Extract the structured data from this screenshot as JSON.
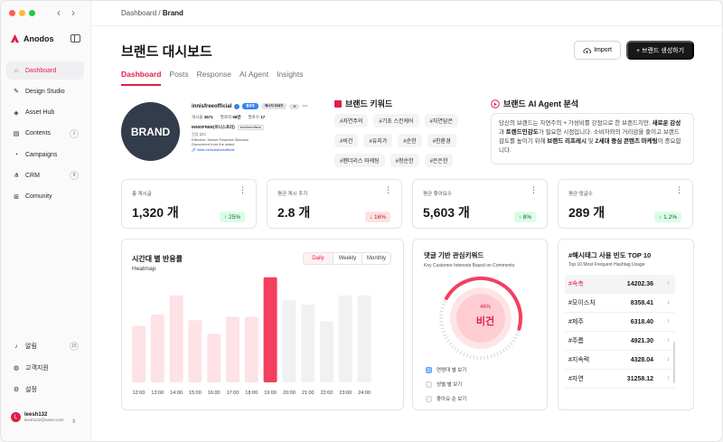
{
  "sidebar": {
    "logo": "Anodos",
    "items": [
      {
        "label": "Dashboard",
        "icon": "home-icon",
        "active": true,
        "badge": ""
      },
      {
        "label": "Design Studio",
        "icon": "pen-icon",
        "active": false,
        "badge": ""
      },
      {
        "label": "Asset Hub",
        "icon": "layers-icon",
        "active": false,
        "badge": ""
      },
      {
        "label": "Contents",
        "icon": "file-icon",
        "active": false,
        "badge": "1"
      },
      {
        "label": "Campaigns",
        "icon": "megaphone-icon",
        "active": false,
        "badge": ""
      },
      {
        "label": "CRM",
        "icon": "share-icon",
        "active": false,
        "badge": "8"
      },
      {
        "label": "Comunity",
        "icon": "grid-icon",
        "active": false,
        "badge": ""
      }
    ],
    "bottom_items": [
      {
        "label": "알림",
        "icon": "bell-icon",
        "badge": "15"
      },
      {
        "label": "고객지원",
        "icon": "chat-icon",
        "badge": ""
      },
      {
        "label": "설정",
        "icon": "gear-icon",
        "badge": ""
      }
    ],
    "user": {
      "initial": "L",
      "name": "leesh132",
      "email": "leesh132@naver.com"
    }
  },
  "header": {
    "breadcrumb_parent": "Dashboard",
    "breadcrumb_sep": " / ",
    "breadcrumb_current": "Brand",
    "title": "브랜드 대시보드",
    "import_label": "Import",
    "create_label": "+ 브랜드 생성하기",
    "tabs": [
      "Dashboard",
      "Posts",
      "Response",
      "AI Agent",
      "Insights"
    ]
  },
  "profile": {
    "logo_text": "BRAND",
    "handle": "innisfreeofficial",
    "follow_label": "팔로우",
    "message_label": "메시지 보내기",
    "add_label": "+i",
    "more_label": "···",
    "posts_label": "게시물",
    "posts_value": "3671",
    "followers_label": "팔로워",
    "followers_value": "58만",
    "following_label": "팔로우",
    "following_value": "17",
    "name": "INNISFREE(이니스프리)",
    "name_tag": "innisfreeofficial",
    "bio_1": "건강 뷰티",
    "bio_2": "Effective. Nature Powered Skincare",
    "bio_3": "Discovered from the island",
    "bio_link": "🔗 linktr.ee/innisfreeofficial"
  },
  "keywords": {
    "title": "브랜드 키워드",
    "chips": [
      "#자연주의",
      "#기초 스킨케어",
      "#자연담은",
      "#비건",
      "#유지가",
      "#순한",
      "#친환경",
      "#헨더리스 마케팅",
      "#청순한",
      "#은은한"
    ]
  },
  "ai_agent": {
    "title": "브랜드 AI Agent 분석",
    "text_1": "당신의 브랜드는 자연주의 + 가성비를 강점으로 한 브랜드지만, ",
    "bold_1": "새로운 감성",
    "text_2": "과 ",
    "bold_2": "트렌드민감도",
    "text_3": "가 필요한 시점입니다. 소비자와의 거리감을 줄이고 브랜드 감도를 높이기 위해 ",
    "bold_3": "브랜드 리프레시",
    "text_4": " 및 ",
    "bold_4": "Z세대 중심 콘텐츠 마케팅",
    "text_5": "이 중요합니다."
  },
  "stats": [
    {
      "label": "총 게시글",
      "value": "1,320 개",
      "change": "↑ 25%",
      "direction": "up"
    },
    {
      "label": "평균 게시 주기",
      "value": "2.8 개",
      "change": "↓ 16%",
      "direction": "down"
    },
    {
      "label": "평균 좋아요수",
      "value": "5,603 개",
      "change": "↑ 8%",
      "direction": "up"
    },
    {
      "label": "평균 댓글수",
      "value": "289 개",
      "change": "↑ 1.2%",
      "direction": "up"
    }
  ],
  "heatmap": {
    "title": "시간대 별 반응률",
    "subtitle": "Heatmap",
    "toggle": [
      "Daily",
      "Weekly",
      "Monthly"
    ],
    "active_toggle": "Daily"
  },
  "chart_data": {
    "type": "bar",
    "title": "시간대 별 반응률",
    "subtitle": "Heatmap",
    "categories": [
      "12:00",
      "13:00",
      "14:00",
      "15:00",
      "16:00",
      "17:00",
      "18:00",
      "19:00",
      "20:00",
      "21:00",
      "22:00",
      "23:00",
      "24:00"
    ],
    "values": [
      50,
      60,
      77,
      55,
      43,
      58,
      58,
      93,
      73,
      69,
      54,
      77,
      77
    ],
    "highlight_index": 7,
    "ylim": [
      0,
      100
    ],
    "colors": {
      "past": "#fde2e6",
      "highlight": "#f43f5e",
      "future": "#f1f1f3"
    }
  },
  "comments": {
    "title": "댓글 기반 관심키워드",
    "subtitle": "Key Customer Interests Based on Comments",
    "pct": "46%",
    "pct_value": 46,
    "keyword": "비건",
    "options": [
      {
        "label": "연령대 별 보기",
        "checked": true
      },
      {
        "label": "성별 별 보기",
        "checked": false
      },
      {
        "label": "좋아요 순 보기",
        "checked": false
      }
    ]
  },
  "hashtags": {
    "title": "#해시태그 사용 빈도 TOP 10",
    "subtitle": "Top 10 Most Frequent Hashtag Usage",
    "rows": [
      {
        "tag": "#속촉",
        "value": "14202.36",
        "arrow": "↑",
        "dir": "up"
      },
      {
        "tag": "#모이스처",
        "value": "8358.41",
        "arrow": "↓",
        "dir": "down"
      },
      {
        "tag": "#제주",
        "value": "6318.40",
        "arrow": "↑",
        "dir": "up"
      },
      {
        "tag": "#주름",
        "value": "4921.30",
        "arrow": "↑",
        "dir": "up"
      },
      {
        "tag": "#지속력",
        "value": "4328.04",
        "arrow": "↓",
        "dir": "down"
      },
      {
        "tag": "#자연",
        "value": "31258.12",
        "arrow": "↑",
        "dir": "up"
      }
    ]
  }
}
